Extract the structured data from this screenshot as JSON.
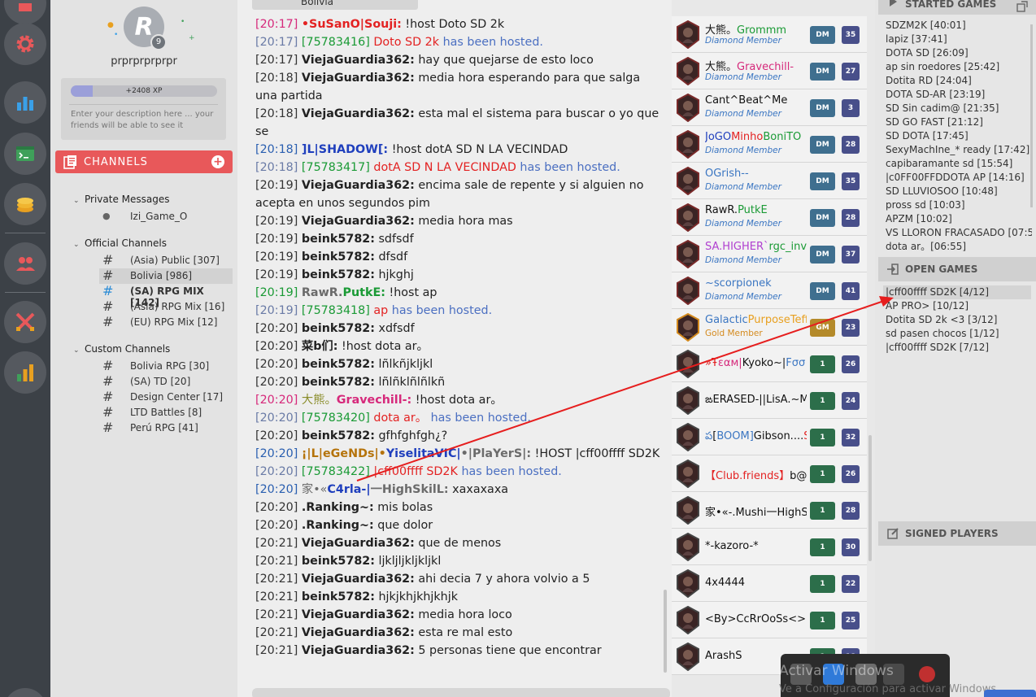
{
  "profile": {
    "avatar_letter": "R",
    "level": "9",
    "username": "prprprprprpr",
    "xp_label": "+2408 XP",
    "xp_progress": 0.15,
    "description_placeholder": "Enter your description here ... your friends will be able to see it"
  },
  "channels": {
    "header": "CHANNELS",
    "add_label": "+",
    "groups": [
      {
        "label": "Private Messages",
        "items": [
          {
            "name": "Izi_Game_O",
            "type": "pm"
          }
        ]
      },
      {
        "label": "Official Channels",
        "items": [
          {
            "name": "(Asia) Public [307]"
          },
          {
            "name": "Bolivia [986]",
            "active": true
          },
          {
            "name": "(SA) RPG MIX [142]",
            "bold": true
          },
          {
            "name": "(Asia) RPG Mix [16]"
          },
          {
            "name": "(EU) RPG Mix [12]"
          }
        ]
      },
      {
        "label": "Custom Channels",
        "items": [
          {
            "name": "Bolivia RPG [30]"
          },
          {
            "name": "(SA) TD [20]"
          },
          {
            "name": "Design Center [17]"
          },
          {
            "name": "LTD Battles [8]"
          },
          {
            "name": "Perú RPG [41]"
          }
        ]
      }
    ]
  },
  "chat": {
    "tab_title": "Bolivia",
    "messages": [
      {
        "ts": "[20:17]",
        "tsc": "pink",
        "parts": [
          [
            "•SuSanO|Souji:",
            "u c-red"
          ],
          [
            " !host Doto SD 2k",
            ""
          ]
        ]
      },
      {
        "ts": "[20:17]",
        "tsc": "gray",
        "parts": [
          [
            "[75783416]",
            "c-green"
          ],
          [
            " Doto SD 2k",
            "c-red"
          ],
          [
            " has been hosted.",
            "c-blue"
          ]
        ]
      },
      {
        "ts": "[20:17]",
        "tsc": "",
        "parts": [
          [
            "ViejaGuardia362:",
            "u"
          ],
          [
            " hay que quejarse de esto loco",
            ""
          ]
        ]
      },
      {
        "ts": "[20:18]",
        "tsc": "",
        "parts": [
          [
            "ViejaGuardia362:",
            "u"
          ],
          [
            " media hora esperando para que salga una partida",
            ""
          ]
        ]
      },
      {
        "ts": "[20:18]",
        "tsc": "",
        "parts": [
          [
            "ViejaGuardia362:",
            "u"
          ],
          [
            " esta mal el sistema para buscar o yo que se",
            ""
          ]
        ]
      },
      {
        "ts": "[20:18]",
        "tsc": "blue",
        "parts": [
          [
            "]L|SHADOW[:",
            "u c-navy"
          ],
          [
            " !host dotA SD N LA VECINDAD",
            ""
          ]
        ]
      },
      {
        "ts": "[20:18]",
        "tsc": "gray",
        "parts": [
          [
            "[75783417]",
            "c-green"
          ],
          [
            " dotA SD N LA VECINDAD",
            "c-red"
          ],
          [
            " has been hosted.",
            "c-blue"
          ]
        ]
      },
      {
        "ts": "[20:19]",
        "tsc": "",
        "parts": [
          [
            "ViejaGuardia362:",
            "u"
          ],
          [
            " encima sale de repente y si alguien no acepta en unos segundos pim",
            ""
          ]
        ]
      },
      {
        "ts": "[20:19]",
        "tsc": "",
        "parts": [
          [
            "ViejaGuardia362:",
            "u"
          ],
          [
            " media hora mas",
            ""
          ]
        ]
      },
      {
        "ts": "[20:19]",
        "tsc": "",
        "parts": [
          [
            "beink5782:",
            "u"
          ],
          [
            " sdfsdf",
            ""
          ]
        ]
      },
      {
        "ts": "[20:19]",
        "tsc": "",
        "parts": [
          [
            "beink5782:",
            "u"
          ],
          [
            " dfsdf",
            ""
          ]
        ]
      },
      {
        "ts": "[20:19]",
        "tsc": "",
        "parts": [
          [
            "beink5782:",
            "u"
          ],
          [
            " hjkghj",
            ""
          ]
        ]
      },
      {
        "ts": "[20:19]",
        "tsc": "green",
        "parts": [
          [
            "RawR.",
            "u c-gray"
          ],
          [
            "PutkE:",
            "u c-green"
          ],
          [
            " !host ap",
            ""
          ]
        ]
      },
      {
        "ts": "[20:19]",
        "tsc": "gray",
        "parts": [
          [
            "[75783418]",
            "c-green"
          ],
          [
            " ap",
            "c-red"
          ],
          [
            " has been hosted.",
            "c-blue"
          ]
        ]
      },
      {
        "ts": "[20:20]",
        "tsc": "",
        "parts": [
          [
            "beink5782:",
            "u"
          ],
          [
            " xdfsdf",
            ""
          ]
        ]
      },
      {
        "ts": "[20:20]",
        "tsc": "",
        "parts": [
          [
            "菜b们:",
            "u"
          ],
          [
            " !host dota ar。",
            ""
          ]
        ]
      },
      {
        "ts": "[20:20]",
        "tsc": "",
        "parts": [
          [
            "beink5782:",
            "u"
          ],
          [
            " lñlkñjkljkl",
            ""
          ]
        ]
      },
      {
        "ts": "[20:20]",
        "tsc": "",
        "parts": [
          [
            "beink5782:",
            "u"
          ],
          [
            " lñlñklñlñlkñ",
            ""
          ]
        ]
      },
      {
        "ts": "[20:20]",
        "tsc": "pink",
        "parts": [
          [
            "大熊。",
            "c-olive"
          ],
          [
            "Gravechill-:",
            "u c-pink"
          ],
          [
            " !host dota ar。",
            ""
          ]
        ]
      },
      {
        "ts": "[20:20]",
        "tsc": "gray",
        "parts": [
          [
            "[75783420]",
            "c-green"
          ],
          [
            " dota ar。",
            "c-red"
          ],
          [
            " has been hosted.",
            "c-blue"
          ]
        ]
      },
      {
        "ts": "[20:20]",
        "tsc": "",
        "parts": [
          [
            "beink5782:",
            "u"
          ],
          [
            " gfhfghfgh¿?",
            ""
          ]
        ]
      },
      {
        "ts": "[20:20]",
        "tsc": "blue",
        "parts": [
          [
            "¡|L|eGeNDs|•",
            "u c-brown"
          ],
          [
            "YiselitaVIC|",
            "u c-navy"
          ],
          [
            "•|PlaYerS|:",
            "u c-gray"
          ],
          [
            " !HOST |cff00ffff ",
            ""
          ],
          [
            "SD2K",
            ""
          ]
        ]
      },
      {
        "ts": "[20:20]",
        "tsc": "gray",
        "parts": [
          [
            "[75783422]",
            "c-green"
          ],
          [
            " |cff00ffff SD2K",
            "c-red"
          ],
          [
            " has been hosted.",
            "c-blue"
          ]
        ]
      },
      {
        "ts": "[20:20]",
        "tsc": "blue",
        "parts": [
          [
            "家•«",
            "c-gray"
          ],
          [
            "C4rla-|",
            "u c-navy"
          ],
          [
            "一HighSkilL:",
            "u c-gray"
          ],
          [
            " xaxaxaxa",
            ""
          ]
        ]
      },
      {
        "ts": "[20:20]",
        "tsc": "",
        "parts": [
          [
            ".Ranking~:",
            "u"
          ],
          [
            " mis bolas",
            ""
          ]
        ]
      },
      {
        "ts": "[20:20]",
        "tsc": "",
        "parts": [
          [
            ".Ranking~:",
            "u"
          ],
          [
            " que dolor",
            ""
          ]
        ]
      },
      {
        "ts": "[20:21]",
        "tsc": "",
        "parts": [
          [
            "ViejaGuardia362:",
            "u"
          ],
          [
            " que de menos",
            ""
          ]
        ]
      },
      {
        "ts": "[20:21]",
        "tsc": "",
        "parts": [
          [
            "beink5782:",
            "u"
          ],
          [
            " ljkljljkljkljkl",
            ""
          ]
        ]
      },
      {
        "ts": "[20:21]",
        "tsc": "",
        "parts": [
          [
            "ViejaGuardia362:",
            "u"
          ],
          [
            " ahi decia 7 y ahora volvio a 5",
            ""
          ]
        ]
      },
      {
        "ts": "[20:21]",
        "tsc": "",
        "parts": [
          [
            "beink5782:",
            "u"
          ],
          [
            " hjkjkhjkhjkhjk",
            ""
          ]
        ]
      },
      {
        "ts": "[20:21]",
        "tsc": "",
        "parts": [
          [
            "ViejaGuardia362:",
            "u"
          ],
          [
            " media hora loco",
            ""
          ]
        ]
      },
      {
        "ts": "[20:21]",
        "tsc": "",
        "parts": [
          [
            "ViejaGuardia362:",
            "u"
          ],
          [
            " esta re mal esto",
            ""
          ]
        ]
      },
      {
        "ts": "[20:21]",
        "tsc": "",
        "parts": [
          [
            "ViejaGuardia362:",
            "u"
          ],
          [
            " 5 personas tiene que encontrar",
            ""
          ]
        ]
      }
    ]
  },
  "players": [
    {
      "name": [
        [
          "大熊。",
          "#111"
        ],
        [
          "Grommm",
          "#1a9a35"
        ]
      ],
      "rank": "Diamond Member",
      "b1": "DM",
      "b2": "35"
    },
    {
      "name": [
        [
          "大熊。",
          "#111"
        ],
        [
          "Gravechill-",
          "#d6297b"
        ]
      ],
      "rank": "Diamond Member",
      "b1": "DM",
      "b2": "27"
    },
    {
      "name": [
        [
          "Cant^Beat^Me",
          "#111"
        ]
      ],
      "rank": "Diamond Member",
      "b1": "DM",
      "b2": "3"
    },
    {
      "name": [
        [
          "JoGO",
          "#1f3fbd"
        ],
        [
          "Minho",
          "#e32222"
        ],
        [
          "BoniTO",
          "#1a9a35"
        ]
      ],
      "rank": "Diamond Member",
      "b1": "DM",
      "b2": "28"
    },
    {
      "name": [
        [
          "OGrish--",
          "#3b76c2"
        ]
      ],
      "rank": "Diamond Member",
      "b1": "DM",
      "b2": "35"
    },
    {
      "name": [
        [
          "RawR.",
          "#111"
        ],
        [
          "PutkE",
          "#1a9a35"
        ]
      ],
      "rank": "Diamond Member",
      "b1": "DM",
      "b2": "28"
    },
    {
      "name": [
        [
          "SA.HIGHER`",
          "#b040d0"
        ],
        [
          "rgc_invi",
          "#1a9a35"
        ]
      ],
      "rank": "Diamond Member",
      "b1": "DM",
      "b2": "37"
    },
    {
      "name": [
        [
          "~scorpionek",
          "#3b76c2"
        ]
      ],
      "rank": "Diamond Member",
      "b1": "DM",
      "b2": "41"
    },
    {
      "name": [
        [
          "Galactic",
          "#3b76c2"
        ],
        [
          "PurposeTeff",
          "#e8a020"
        ]
      ],
      "rank": "Gold Member",
      "b1": "GM",
      "b2": "23"
    },
    {
      "name": [
        [
          "»Ŧ",
          "#e32222"
        ],
        [
          "ɛαм|",
          "#d6297b"
        ],
        [
          "Kyoko~|",
          "#111"
        ],
        [
          "Fσσ",
          "#3b76c2"
        ]
      ],
      "rank": "",
      "b1": "1",
      "b2": "26"
    },
    {
      "name": [
        [
          "ఙERASED-||LisA.~Ma",
          "#111"
        ]
      ],
      "rank": "",
      "b1": "1",
      "b2": "24"
    },
    {
      "name": [
        [
          "ప",
          "#3b76c2"
        ],
        [
          "[",
          "#111"
        ],
        [
          "BOOM]",
          "#3b76c2"
        ],
        [
          "Gibson....",
          "#111"
        ],
        [
          "S",
          "#e32222"
        ]
      ],
      "rank": "",
      "b1": "1",
      "b2": "32"
    },
    {
      "name": [
        [
          "【Club.friends】",
          "#e32222"
        ],
        [
          "b@",
          "#111"
        ]
      ],
      "rank": "",
      "b1": "1",
      "b2": "26"
    },
    {
      "name": [
        [
          "家•«-.Mushi一HighS",
          "#111"
        ]
      ],
      "rank": "",
      "b1": "1",
      "b2": "28"
    },
    {
      "name": [
        [
          "*-kazoro-*",
          "#111"
        ]
      ],
      "rank": "",
      "b1": "1",
      "b2": "30"
    },
    {
      "name": [
        [
          "4x4444",
          "#111"
        ]
      ],
      "rank": "",
      "b1": "1",
      "b2": "22"
    },
    {
      "name": [
        [
          "<By>CcRrOoSs<>",
          "#111"
        ]
      ],
      "rank": "",
      "b1": "1",
      "b2": "25"
    },
    {
      "name": [
        [
          "ArashS",
          "#111"
        ]
      ],
      "rank": "",
      "b1": "1",
      "b2": "18"
    }
  ],
  "games": {
    "started_header": "STARTED GAMES",
    "started": [
      "SDZM2K [40:01]",
      "lapiz [37:41]",
      "DOTA SD [26:09]",
      "ap sin roedores [25:42]",
      "Dotita RD [24:04]",
      "DOTA SD-AR [23:19]",
      "SD Sin cadim@ [21:35]",
      "SD GO FAST [21:12]",
      "SD DOTA [17:45]",
      "SexyMachIne_* ready [17:42]",
      "capibaramante sd [15:54]",
      "|c0FF00FFDDOTA AP [14:16]",
      "SD LLUVIOSOO [10:48]",
      "pross sd [10:03]",
      "APZM [10:02]",
      "VS LLORON FRACASADO [07:5",
      "dota ar。[06:55]"
    ],
    "open_header": "OPEN GAMES",
    "open": [
      "|cff00ffff SD2K [4/12]",
      "AP PRO> [10/12]",
      "Dotita SD 2k <3 [3/12]",
      "sd pasen chocos [1/12]",
      "|cff00ffff SD2K [7/12]"
    ],
    "signed_header": "SIGNED PLAYERS"
  },
  "os": {
    "watermark_title": "Activar Windows",
    "watermark_sub": "Ve a Configuración para activar Windows."
  },
  "colors": {
    "accent_red": "#e8585a",
    "rail_bg": "#3c4147",
    "rail_icon": "#e8585a",
    "annotation_arrow": "#e61e1e"
  }
}
